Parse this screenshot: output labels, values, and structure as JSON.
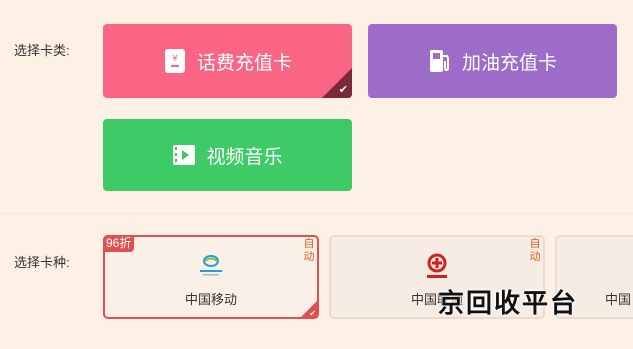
{
  "card_type": {
    "label": "选择卡类:",
    "options": [
      {
        "name": "话费充值卡",
        "icon": "phone-card-icon",
        "color": "#fb6584",
        "selected": true
      },
      {
        "name": "加油充值卡",
        "icon": "fuel-pump-icon",
        "color": "#9c6cc8",
        "selected": false
      },
      {
        "name": "视频音乐",
        "icon": "video-icon",
        "color": "#3fca68",
        "selected": false
      }
    ]
  },
  "carrier": {
    "label": "选择卡种:",
    "options": [
      {
        "name": "中国移动",
        "logo": "china-mobile-logo",
        "badge": "96折",
        "auto": "自动",
        "selected": true
      },
      {
        "name": "中国联通",
        "logo": "china-unicom-logo",
        "auto": "自动",
        "selected": false
      },
      {
        "name": "中国",
        "selected": false
      }
    ]
  },
  "watermark": "京回收平台",
  "colors": {
    "background": "#fdf1e6",
    "selected_border": "#e05050",
    "auto_text": "#e06020"
  }
}
